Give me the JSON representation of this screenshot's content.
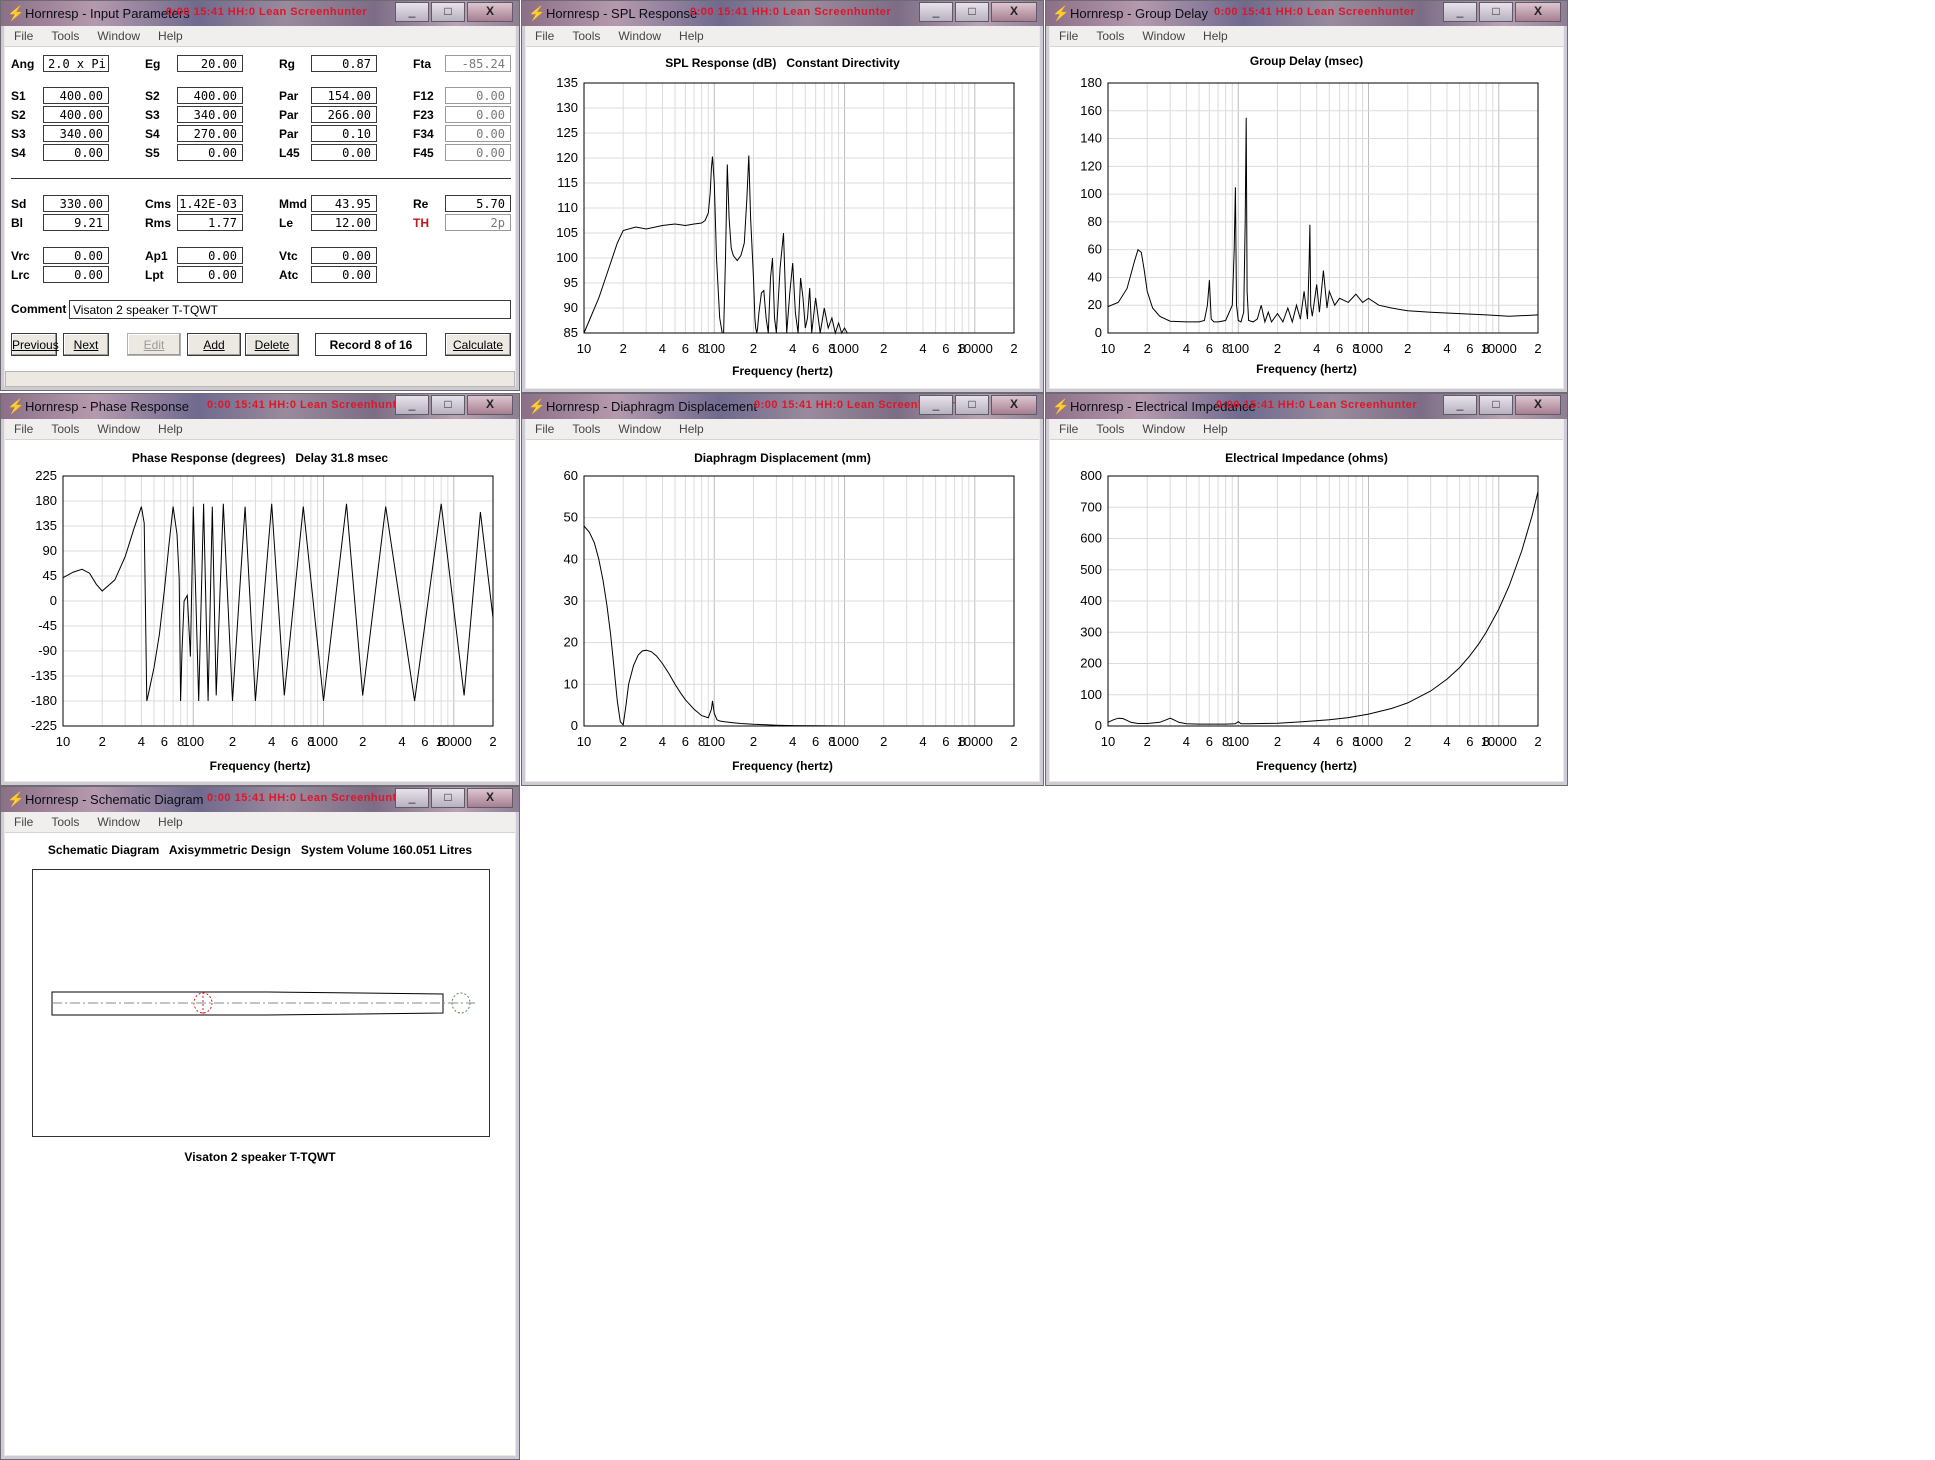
{
  "windows": {
    "input": {
      "title": "Hornresp - Input Parameters",
      "overlay": "0:00  15:41  HH:0   Lean   Screenhunter"
    },
    "spl": {
      "title": "Hornresp - SPL Response",
      "overlay": "0:00  15:41  HH:0   Lean   Screenhunter"
    },
    "gd": {
      "title": "Hornresp - Group Delay",
      "overlay": "0:00  15:41  HH:0   Lean   Screenhunter"
    },
    "phase": {
      "title": "Hornresp - Phase Response",
      "overlay": "0:00  15:41  HH:0   Lean   Screenhunter"
    },
    "disp": {
      "title": "Hornresp - Diaphragm Displacement",
      "overlay": "0:00  15:41  HH:0   Lean   Screenhunter"
    },
    "imp": {
      "title": "Hornresp - Electrical Impedance",
      "overlay": "0:00  15:41  HH:0   Lean   Screenhunter"
    },
    "schem": {
      "title": "Hornresp - Schematic Diagram",
      "overlay": "0:00  15:41  HH:0   Lean   Screenhunter"
    }
  },
  "menu": {
    "file": "File",
    "tools": "Tools",
    "window": "Window",
    "help": "Help"
  },
  "controls": {
    "minimize": "_",
    "maximize": "□",
    "close": "X"
  },
  "params": {
    "ang": {
      "label": "Ang",
      "value": "2.0 x Pi"
    },
    "eg": {
      "label": "Eg",
      "value": "20.00"
    },
    "rg": {
      "label": "Rg",
      "value": "0.87"
    },
    "fta": {
      "label": "Fta",
      "value": "-85.24"
    },
    "s1": {
      "label": "S1",
      "value": "400.00"
    },
    "s2a": {
      "label": "S2",
      "value": "400.00"
    },
    "par1": {
      "label": "Par",
      "value": "154.00"
    },
    "f12": {
      "label": "F12",
      "value": "0.00"
    },
    "s2b": {
      "label": "S2",
      "value": "400.00"
    },
    "s3a": {
      "label": "S3",
      "value": "340.00"
    },
    "par2": {
      "label": "Par",
      "value": "266.00"
    },
    "f23": {
      "label": "F23",
      "value": "0.00"
    },
    "s3b": {
      "label": "S3",
      "value": "340.00"
    },
    "s4a": {
      "label": "S4",
      "value": "270.00"
    },
    "par3": {
      "label": "Par",
      "value": "0.10"
    },
    "f34": {
      "label": "F34",
      "value": "0.00"
    },
    "s4b": {
      "label": "S4",
      "value": "0.00"
    },
    "s5": {
      "label": "S5",
      "value": "0.00"
    },
    "l45": {
      "label": "L45",
      "value": "0.00"
    },
    "f45": {
      "label": "F45",
      "value": "0.00"
    },
    "sd": {
      "label": "Sd",
      "value": "330.00"
    },
    "cms": {
      "label": "Cms",
      "value": "1.42E-03"
    },
    "mmd": {
      "label": "Mmd",
      "value": "43.95"
    },
    "re": {
      "label": "Re",
      "value": "5.70"
    },
    "bl": {
      "label": "Bl",
      "value": "9.21"
    },
    "rms": {
      "label": "Rms",
      "value": "1.77"
    },
    "le": {
      "label": "Le",
      "value": "12.00"
    },
    "th": {
      "label": "TH",
      "value": "2p"
    },
    "vrc": {
      "label": "Vrc",
      "value": "0.00"
    },
    "ap1": {
      "label": "Ap1",
      "value": "0.00"
    },
    "vtc": {
      "label": "Vtc",
      "value": "0.00"
    },
    "lrc": {
      "label": "Lrc",
      "value": "0.00"
    },
    "lpt": {
      "label": "Lpt",
      "value": "0.00"
    },
    "atc": {
      "label": "Atc",
      "value": "0.00"
    },
    "comment_label": "Comment",
    "comment_value": "Visaton 2 speaker T-TQWT"
  },
  "buttons": {
    "previous": "Previous",
    "next": "Next",
    "edit": "Edit",
    "add": "Add",
    "delete": "Delete",
    "record": "Record 8 of 16",
    "calculate": "Calculate"
  },
  "xaxis": {
    "label": "Frequency (hertz)",
    "ticks": [
      {
        "f": 10,
        "t": "10"
      },
      {
        "f": 20,
        "t": "2"
      },
      {
        "f": 40,
        "t": "4"
      },
      {
        "f": 60,
        "t": "6"
      },
      {
        "f": 80,
        "t": "8"
      },
      {
        "f": 100,
        "t": "100"
      },
      {
        "f": 200,
        "t": "2"
      },
      {
        "f": 400,
        "t": "4"
      },
      {
        "f": 600,
        "t": "6"
      },
      {
        "f": 800,
        "t": "8"
      },
      {
        "f": 1000,
        "t": "1000"
      },
      {
        "f": 2000,
        "t": "2"
      },
      {
        "f": 4000,
        "t": "4"
      },
      {
        "f": 6000,
        "t": "6"
      },
      {
        "f": 8000,
        "t": "8"
      },
      {
        "f": 10000,
        "t": "10000"
      },
      {
        "f": 20000,
        "t": "2"
      }
    ]
  },
  "chart_data": [
    {
      "id": "spl",
      "type": "line",
      "title": "SPL Response (dB)   Constant Directivity",
      "xlabel": "Frequency (hertz)",
      "xscale": "log",
      "xlim": [
        10,
        20000
      ],
      "ylim": [
        85,
        135
      ],
      "yticks": [
        85,
        90,
        95,
        100,
        105,
        110,
        115,
        120,
        125,
        130,
        135
      ],
      "grid": true,
      "x": [
        10,
        13,
        16,
        18,
        20,
        25,
        30,
        40,
        50,
        60,
        70,
        80,
        85,
        90,
        93,
        95,
        97,
        100,
        104,
        110,
        115,
        118,
        122,
        126,
        130,
        135,
        140,
        150,
        160,
        170,
        178,
        184,
        190,
        200,
        205,
        208,
        212,
        215,
        220,
        230,
        240,
        250,
        260,
        270,
        280,
        290,
        300,
        320,
        340,
        360,
        380,
        400,
        420,
        440,
        460,
        480,
        500,
        520,
        540,
        560,
        600,
        650,
        700,
        750,
        800,
        850,
        900,
        950,
        1000,
        1050
      ],
      "y": [
        85,
        92,
        99,
        103,
        105.5,
        106.2,
        105.8,
        106.5,
        106.8,
        106.5,
        106.8,
        107,
        107.5,
        109,
        113,
        118,
        120.3,
        115,
        100,
        88,
        85,
        85,
        100,
        118.7,
        108,
        102,
        100.5,
        99.5,
        100.5,
        103,
        112,
        120.5,
        108,
        96,
        88,
        86,
        85,
        86,
        89,
        93,
        93.5,
        88,
        85,
        96,
        100,
        88,
        85,
        98,
        105,
        85,
        93,
        99,
        89,
        85,
        96,
        92,
        86,
        88,
        94,
        85,
        92,
        85,
        90,
        86,
        88,
        85,
        87,
        85,
        86,
        85
      ]
    },
    {
      "id": "gd",
      "type": "line",
      "title": "Group Delay (msec)",
      "xlabel": "Frequency (hertz)",
      "xscale": "log",
      "xlim": [
        10,
        20000
      ],
      "ylim": [
        0,
        180
      ],
      "yticks": [
        0,
        20,
        40,
        60,
        80,
        100,
        120,
        140,
        160,
        180
      ],
      "grid": true,
      "x": [
        10,
        12,
        14,
        16,
        17,
        18,
        19,
        20,
        22,
        25,
        30,
        40,
        50,
        55,
        58,
        60,
        62,
        65,
        70,
        80,
        90,
        93,
        95,
        97,
        100,
        105,
        110,
        113,
        115,
        117,
        120,
        130,
        140,
        150,
        160,
        170,
        180,
        200,
        220,
        240,
        260,
        280,
        300,
        320,
        340,
        350,
        355,
        360,
        370,
        400,
        420,
        450,
        480,
        500,
        550,
        600,
        700,
        800,
        900,
        1000,
        1200,
        1500,
        2000,
        3000,
        5000,
        8000,
        12000,
        20000
      ],
      "y": [
        19,
        22,
        32,
        52,
        60,
        58,
        45,
        30,
        18,
        12,
        8.5,
        8,
        8,
        9,
        20,
        38,
        10,
        8,
        8,
        9,
        20,
        60,
        105,
        20,
        9,
        8,
        15,
        80,
        155,
        30,
        9,
        8,
        10,
        20,
        8,
        15,
        8,
        14,
        8,
        18,
        8,
        20,
        10,
        30,
        10,
        50,
        78,
        20,
        12,
        35,
        15,
        45,
        18,
        30,
        20,
        25,
        22,
        28,
        22,
        25,
        20,
        18,
        16,
        15,
        14,
        13,
        12,
        13
      ]
    },
    {
      "id": "phase",
      "type": "line",
      "title": "Phase Response (degrees)   Delay 31.8 msec",
      "xlabel": "Frequency (hertz)",
      "xscale": "log",
      "xlim": [
        10,
        20000
      ],
      "ylim": [
        -225,
        225
      ],
      "yticks": [
        -225,
        -180,
        -135,
        -90,
        -45,
        0,
        45,
        90,
        135,
        180,
        225
      ],
      "grid": true,
      "x": [
        10,
        12,
        14,
        16,
        18,
        20,
        25,
        30,
        35,
        40,
        42,
        44,
        45,
        50,
        55,
        60,
        65,
        70,
        75,
        78,
        80,
        82,
        85,
        90,
        95,
        100,
        110,
        120,
        130,
        140,
        150,
        170,
        200,
        250,
        300,
        400,
        500,
        700,
        1000,
        1500,
        2000,
        3000,
        5000,
        8000,
        12000,
        16000,
        20000
      ],
      "y": [
        42,
        52,
        57,
        50,
        30,
        18,
        38,
        80,
        130,
        170,
        140,
        -180,
        -170,
        -120,
        -60,
        20,
        100,
        170,
        120,
        40,
        -180,
        -90,
        0,
        10,
        -100,
        170,
        -180,
        175,
        -180,
        170,
        -170,
        175,
        -180,
        170,
        -180,
        175,
        -170,
        170,
        -180,
        175,
        -170,
        170,
        -180,
        175,
        -170,
        160,
        -30
      ]
    },
    {
      "id": "disp",
      "type": "line",
      "title": "Diaphragm Displacement (mm)",
      "xlabel": "Frequency (hertz)",
      "xscale": "log",
      "xlim": [
        10,
        20000
      ],
      "ylim": [
        0,
        60
      ],
      "yticks": [
        0,
        10,
        20,
        30,
        40,
        50,
        60
      ],
      "grid": true,
      "x": [
        10,
        11,
        12,
        13,
        14,
        15,
        16,
        17,
        18,
        19,
        20,
        21,
        22,
        24,
        26,
        28,
        30,
        33,
        36,
        40,
        45,
        50,
        55,
        60,
        70,
        80,
        90,
        95,
        97,
        100,
        105,
        110,
        120,
        140,
        160,
        200,
        250,
        300,
        400,
        600,
        1000,
        20000
      ],
      "y": [
        48,
        46.5,
        44,
        40,
        35,
        29,
        22,
        14,
        6,
        1,
        0.3,
        5,
        10,
        14.5,
        17,
        18,
        18.2,
        17.8,
        16.8,
        15,
        12.5,
        10,
        8,
        6.3,
        4,
        2.5,
        2,
        4,
        6,
        3,
        1.5,
        1.2,
        1,
        0.8,
        0.6,
        0.4,
        0.3,
        0.2,
        0.1,
        0.05,
        0,
        0
      ]
    },
    {
      "id": "imp",
      "type": "line",
      "title": "Electrical Impedance (ohms)",
      "xlabel": "Frequency (hertz)",
      "xscale": "log",
      "xlim": [
        10,
        20000
      ],
      "ylim": [
        0,
        800
      ],
      "yticks": [
        0,
        100,
        200,
        300,
        400,
        500,
        600,
        700,
        800
      ],
      "grid": true,
      "x": [
        10,
        11,
        12,
        13,
        14,
        15,
        17,
        20,
        25,
        28,
        30,
        32,
        35,
        40,
        50,
        60,
        80,
        95,
        100,
        105,
        120,
        150,
        200,
        300,
        500,
        700,
        1000,
        1500,
        2000,
        3000,
        4000,
        5000,
        6000,
        7000,
        8000,
        10000,
        12000,
        15000,
        18000,
        20000
      ],
      "y": [
        12,
        20,
        25,
        24,
        18,
        12,
        8,
        8,
        12,
        20,
        25,
        20,
        12,
        7,
        6,
        6,
        6,
        7,
        14,
        7,
        7,
        8,
        9,
        13,
        20,
        27,
        38,
        56,
        74,
        112,
        150,
        187,
        225,
        262,
        300,
        374,
        448,
        560,
        672,
        750
      ]
    }
  ],
  "schematic": {
    "title": "Schematic Diagram   Axisymmetric Design   System Volume 160.051 Litres",
    "caption": "Visaton 2 speaker T-TQWT"
  }
}
